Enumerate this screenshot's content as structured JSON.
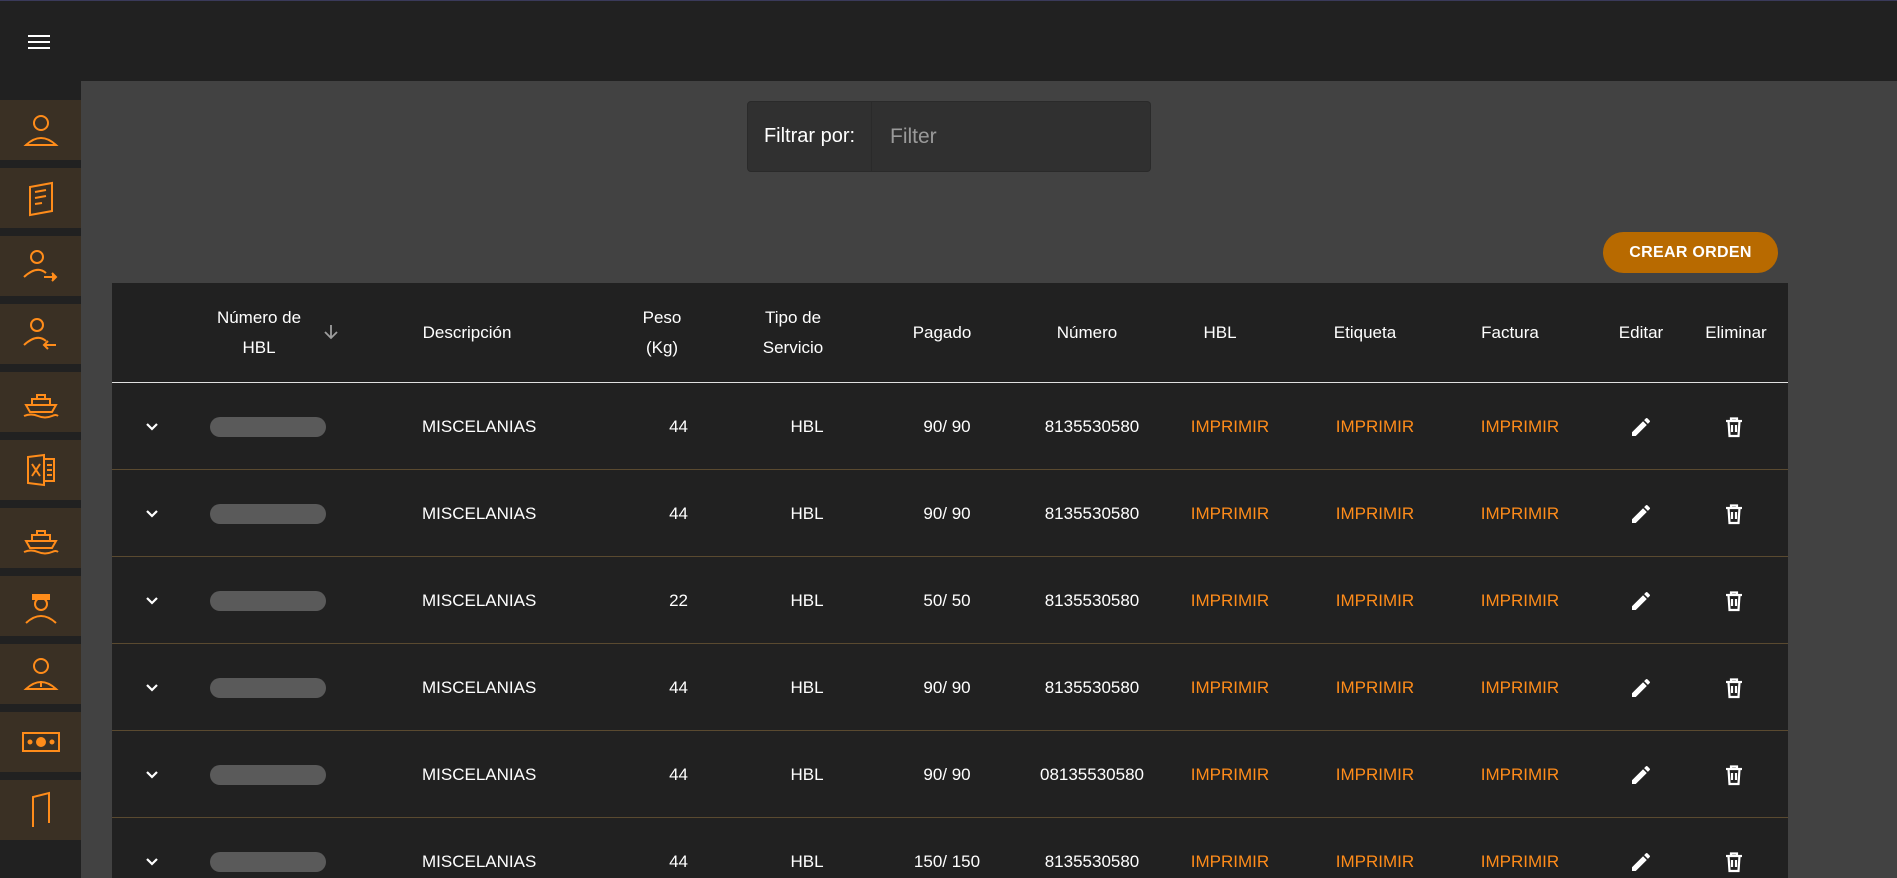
{
  "filter": {
    "label": "Filtrar por:",
    "placeholder": "Filter",
    "value": ""
  },
  "actions": {
    "create_order": "CREAR ORDEN"
  },
  "sidebar": {
    "items": [
      {
        "icon": "user-icon"
      },
      {
        "icon": "document-icon"
      },
      {
        "icon": "user-export-icon"
      },
      {
        "icon": "user-import-icon"
      },
      {
        "icon": "ship-icon"
      },
      {
        "icon": "excel-icon"
      },
      {
        "icon": "ship-icon"
      },
      {
        "icon": "driver-icon"
      },
      {
        "icon": "user-info-icon"
      },
      {
        "icon": "cash-icon"
      },
      {
        "icon": "door-icon"
      }
    ]
  },
  "table": {
    "headers": {
      "hbl_number": "Número de HBL",
      "description": "Descripción",
      "weight": "Peso (Kg)",
      "service_type": "Tipo de Servicio",
      "paid": "Pagado",
      "number": "Número",
      "hbl": "HBL",
      "label": "Etiqueta",
      "invoice": "Factura",
      "edit": "Editar",
      "delete": "Eliminar"
    },
    "rows": [
      {
        "description": "MISCELANIAS",
        "weight": "44",
        "service": "HBL",
        "paid": "90/ 90",
        "number": "8135530580",
        "hbl": "IMPRIMIR",
        "label": "IMPRIMIR",
        "invoice": "IMPRIMIR"
      },
      {
        "description": "MISCELANIAS",
        "weight": "44",
        "service": "HBL",
        "paid": "90/ 90",
        "number": "8135530580",
        "hbl": "IMPRIMIR",
        "label": "IMPRIMIR",
        "invoice": "IMPRIMIR"
      },
      {
        "description": "MISCELANIAS",
        "weight": "22",
        "service": "HBL",
        "paid": "50/ 50",
        "number": "8135530580",
        "hbl": "IMPRIMIR",
        "label": "IMPRIMIR",
        "invoice": "IMPRIMIR"
      },
      {
        "description": "MISCELANIAS",
        "weight": "44",
        "service": "HBL",
        "paid": "90/ 90",
        "number": "8135530580",
        "hbl": "IMPRIMIR",
        "label": "IMPRIMIR",
        "invoice": "IMPRIMIR"
      },
      {
        "description": "MISCELANIAS",
        "weight": "44",
        "service": "HBL",
        "paid": "90/ 90",
        "number": "08135530580",
        "hbl": "IMPRIMIR",
        "label": "IMPRIMIR",
        "invoice": "IMPRIMIR"
      },
      {
        "description": "MISCELANIAS",
        "weight": "44",
        "service": "HBL",
        "paid": "150/ 150",
        "number": "8135530580",
        "hbl": "IMPRIMIR",
        "label": "IMPRIMIR",
        "invoice": "IMPRIMIR"
      }
    ]
  },
  "colors": {
    "accent": "#ff8c1a",
    "button": "#b86a00",
    "background": "#424242",
    "surface": "#212121"
  }
}
